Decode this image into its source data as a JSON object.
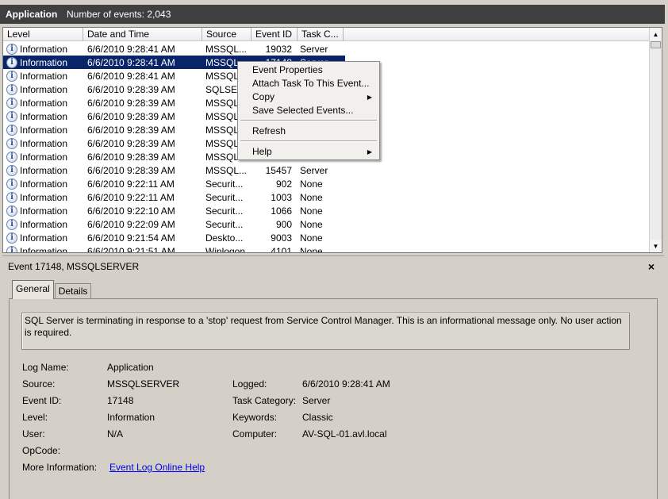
{
  "header": {
    "title": "Application",
    "count": "Number of events: 2,043"
  },
  "columns": [
    "Level",
    "Date and Time",
    "Source",
    "Event ID",
    "Task C..."
  ],
  "rows": [
    {
      "level": "Information",
      "date": "6/6/2010 9:28:41 AM",
      "source": "MSSQL...",
      "id": "19032",
      "task": "Server"
    },
    {
      "level": "Information",
      "date": "6/6/2010 9:28:41 AM",
      "source": "MSSQL...",
      "id": "17148",
      "task": "Server"
    },
    {
      "level": "Information",
      "date": "6/6/2010 9:28:41 AM",
      "source": "MSSQL...",
      "id": "",
      "task": ""
    },
    {
      "level": "Information",
      "date": "6/6/2010 9:28:39 AM",
      "source": "SQLSE...",
      "id": "",
      "task": ""
    },
    {
      "level": "Information",
      "date": "6/6/2010 9:28:39 AM",
      "source": "MSSQL...",
      "id": "",
      "task": ""
    },
    {
      "level": "Information",
      "date": "6/6/2010 9:28:39 AM",
      "source": "MSSQL...",
      "id": "",
      "task": ""
    },
    {
      "level": "Information",
      "date": "6/6/2010 9:28:39 AM",
      "source": "MSSQL...",
      "id": "",
      "task": ""
    },
    {
      "level": "Information",
      "date": "6/6/2010 9:28:39 AM",
      "source": "MSSQL...",
      "id": "",
      "task": ""
    },
    {
      "level": "Information",
      "date": "6/6/2010 9:28:39 AM",
      "source": "MSSQL...",
      "id": "",
      "task": ""
    },
    {
      "level": "Information",
      "date": "6/6/2010 9:28:39 AM",
      "source": "MSSQL...",
      "id": "15457",
      "task": "Server"
    },
    {
      "level": "Information",
      "date": "6/6/2010 9:22:11 AM",
      "source": "Securit...",
      "id": "902",
      "task": "None"
    },
    {
      "level": "Information",
      "date": "6/6/2010 9:22:11 AM",
      "source": "Securit...",
      "id": "1003",
      "task": "None"
    },
    {
      "level": "Information",
      "date": "6/6/2010 9:22:10 AM",
      "source": "Securit...",
      "id": "1066",
      "task": "None"
    },
    {
      "level": "Information",
      "date": "6/6/2010 9:22:09 AM",
      "source": "Securit...",
      "id": "900",
      "task": "None"
    },
    {
      "level": "Information",
      "date": "6/6/2010 9:21:54 AM",
      "source": "Deskto...",
      "id": "9003",
      "task": "None"
    },
    {
      "level": "Information",
      "date": "6/6/2010 9:21:51 AM",
      "source": "Winlogon",
      "id": "4101",
      "task": "None"
    }
  ],
  "context_menu": {
    "event_properties": "Event Properties",
    "attach_task": "Attach Task To This Event...",
    "copy": "Copy",
    "save_selected": "Save Selected Events...",
    "refresh": "Refresh",
    "help": "Help"
  },
  "detail": {
    "title": "Event 17148, MSSQLSERVER",
    "close_glyph": "×",
    "tabs": [
      "General",
      "Details"
    ],
    "message": "SQL Server is terminating in response to a 'stop' request from Service Control Manager. This is an informational message only. No user action is required.",
    "labels": {
      "log_name": "Log Name:",
      "source": "Source:",
      "event_id": "Event ID:",
      "level": "Level:",
      "user": "User:",
      "opcode": "OpCode:",
      "more_info": "More Information:",
      "logged": "Logged:",
      "task_category": "Task Category:",
      "keywords": "Keywords:",
      "computer": "Computer:"
    },
    "values": {
      "log_name": "Application",
      "source": "MSSQLSERVER",
      "event_id": "17148",
      "level": "Information",
      "user": "N/A",
      "opcode": "",
      "more_info": "Event Log Online Help",
      "logged": "6/6/2010 9:28:41 AM",
      "task_category": "Server",
      "keywords": "Classic",
      "computer": "AV-SQL-01.avl.local"
    }
  },
  "icons": {
    "info": "information-icon",
    "arrow_up": "▲",
    "arrow_down": "▼",
    "submenu": "▶"
  },
  "colors": {
    "selection": "#0a246a",
    "header_bar": "#3f3f3f",
    "link": "#0000ee"
  }
}
